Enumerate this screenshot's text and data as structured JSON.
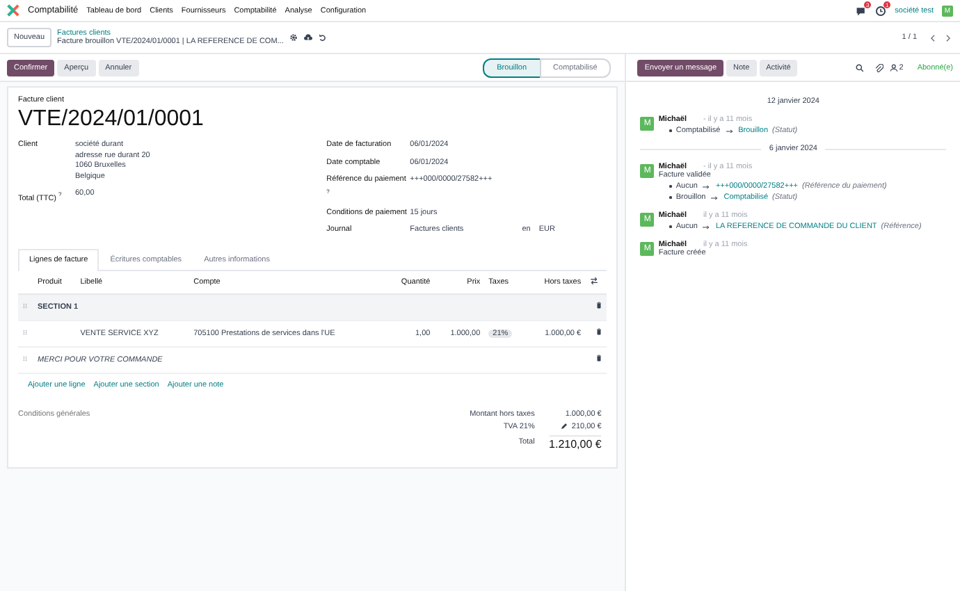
{
  "navbar": {
    "app_name": "Comptabilité",
    "menu": [
      "Tableau de bord",
      "Clients",
      "Fournisseurs",
      "Comptabilité",
      "Analyse",
      "Configuration"
    ],
    "message_count": "3",
    "activity_count": "1",
    "company": "société test",
    "avatar_initial": "M"
  },
  "control_panel": {
    "new_button": "Nouveau",
    "breadcrumb_parent": "Factures clients",
    "breadcrumb_current": "Facture brouillon VTE/2024/01/0001 | LA REFERENCE DE COM...",
    "pager": "1 / 1"
  },
  "actions": [
    {
      "label": "Confirmer",
      "kind": "primary"
    },
    {
      "label": "Aperçu",
      "kind": "secondary"
    },
    {
      "label": "Annuler",
      "kind": "secondary"
    }
  ],
  "statusbar": [
    {
      "label": "Brouillon",
      "selected": true
    },
    {
      "label": "Comptabilisé",
      "selected": false
    }
  ],
  "form": {
    "type_label": "Facture client",
    "number": "VTE/2024/01/0001",
    "client": {
      "label": "Client",
      "lines": [
        "société durant",
        "adresse rue durant 20",
        "1060 Bruxelles",
        "Belgique"
      ]
    },
    "total": {
      "label": "Total (TTC)",
      "help": "?",
      "value": "60,00"
    },
    "right_fields": [
      {
        "label": "Date de facturation",
        "value": "06/01/2024"
      },
      {
        "label": "Date comptable",
        "value": "06/01/2024"
      },
      {
        "label": "Référence du paiement",
        "help": "?",
        "value": "+++000/0000/27582+++"
      },
      {
        "label": "Conditions de paiement",
        "value": "15 jours"
      },
      {
        "label": "Journal",
        "value": "Factures clients",
        "extra_label": "en",
        "extra_value": "EUR"
      }
    ],
    "tabs": [
      {
        "label": "Lignes de facture",
        "selected": true
      },
      {
        "label": "Écritures comptables",
        "selected": false
      },
      {
        "label": "Autres informations",
        "selected": false
      }
    ],
    "columns": [
      "Produit",
      "Libellé",
      "Compte",
      "Quantité",
      "Prix",
      "Taxes",
      "Hors taxes"
    ],
    "rows": [
      {
        "kind": "section",
        "label": "SECTION 1"
      },
      {
        "kind": "line",
        "label": "VENTE SERVICE XYZ",
        "account": "705100 Prestations de services dans l'UE",
        "quantity": "1,00",
        "price": "1.000,00",
        "tax": "21%",
        "subtotal": "1.000,00 €"
      },
      {
        "kind": "note",
        "label": "MERCI POUR VOTRE COMMANDE"
      }
    ],
    "add_links": [
      "Ajouter une ligne",
      "Ajouter une section",
      "Ajouter une note"
    ],
    "terms": {
      "placeholder": "Conditions générales"
    },
    "totals": [
      {
        "label": "Montant hors taxes",
        "value": "1.000,00 €",
        "kind": "plain"
      },
      {
        "label": "TVA 21%",
        "value": "210,00 €",
        "kind": "editable"
      },
      {
        "label": "Total",
        "value": "1.210,00 €",
        "kind": "grand"
      }
    ]
  },
  "chatter": {
    "buttons": [
      {
        "label": "Envoyer un message",
        "kind": "primary"
      },
      {
        "label": "Note",
        "kind": "secondary"
      },
      {
        "label": "Activité",
        "kind": "secondary"
      }
    ],
    "followers": "2",
    "follow_label": "Abonné(e)",
    "items": [
      {
        "kind": "date",
        "label": "12 janvier 2024"
      },
      {
        "kind": "message",
        "initial": "M",
        "author": "Michaël",
        "time": "- il y a 11 mois",
        "changes": [
          {
            "old": "Comptabilisé",
            "new": "Brouillon",
            "field": "(Statut)"
          }
        ]
      },
      {
        "kind": "date",
        "label": "6 janvier 2024"
      },
      {
        "kind": "message",
        "initial": "M",
        "author": "Michaël",
        "time": "- il y a 11 mois",
        "body": "Facture validée",
        "changes": [
          {
            "old": "Aucun",
            "new": "+++000/0000/27582+++",
            "field": "(Référence du paiement)"
          },
          {
            "old": "Brouillon",
            "new": "Comptabilisé",
            "field": "(Statut)"
          }
        ]
      },
      {
        "kind": "message",
        "initial": "M",
        "author": "Michaël",
        "time": "il y a 11 mois",
        "changes": [
          {
            "old": "Aucun",
            "new": "LA REFERENCE DE COMMANDE DU CLIENT",
            "field": "(Référence)"
          }
        ]
      },
      {
        "kind": "message",
        "initial": "M",
        "author": "Michaël",
        "time": "il y a 11 mois",
        "body": "Facture créée"
      }
    ]
  }
}
